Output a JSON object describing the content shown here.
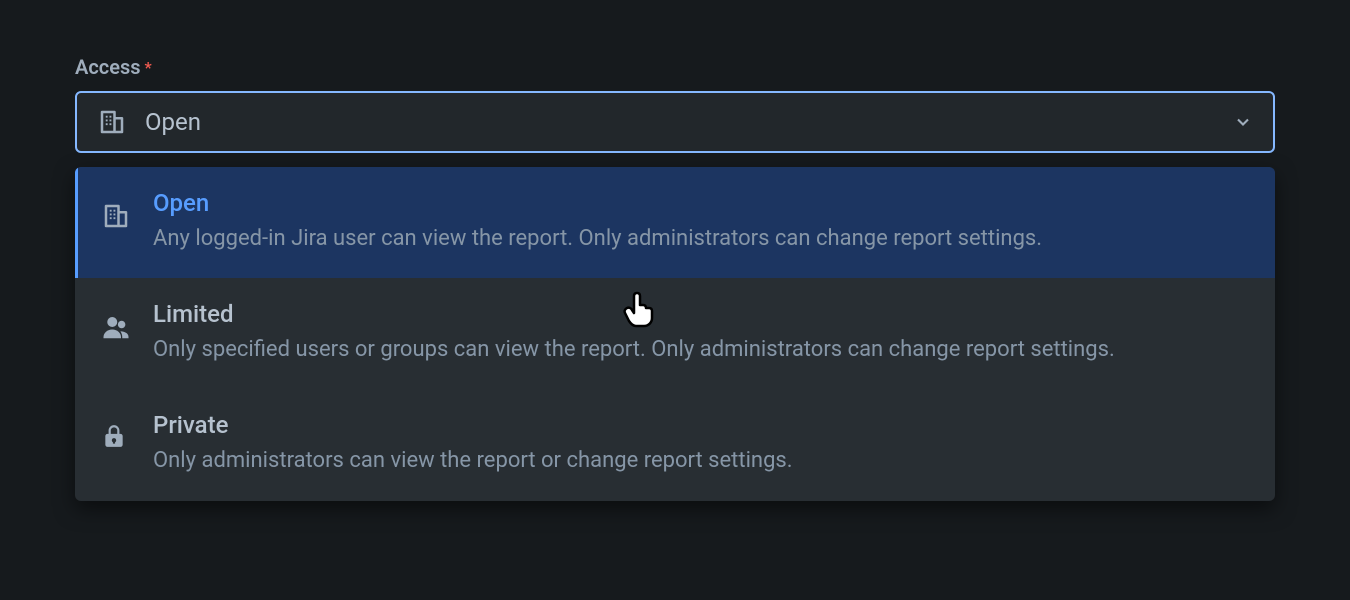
{
  "field": {
    "label": "Access",
    "required_mark": "*",
    "selected_value": "Open"
  },
  "options": [
    {
      "icon": "building-icon",
      "title": "Open",
      "description": "Any logged-in Jira user can view the report. Only administrators can change report settings.",
      "selected": true
    },
    {
      "icon": "users-icon",
      "title": "Limited",
      "description": "Only specified users or groups can view the report. Only administrators can change report settings.",
      "selected": false
    },
    {
      "icon": "lock-icon",
      "title": "Private",
      "description": "Only administrators can view the report or change report settings.",
      "selected": false
    }
  ]
}
